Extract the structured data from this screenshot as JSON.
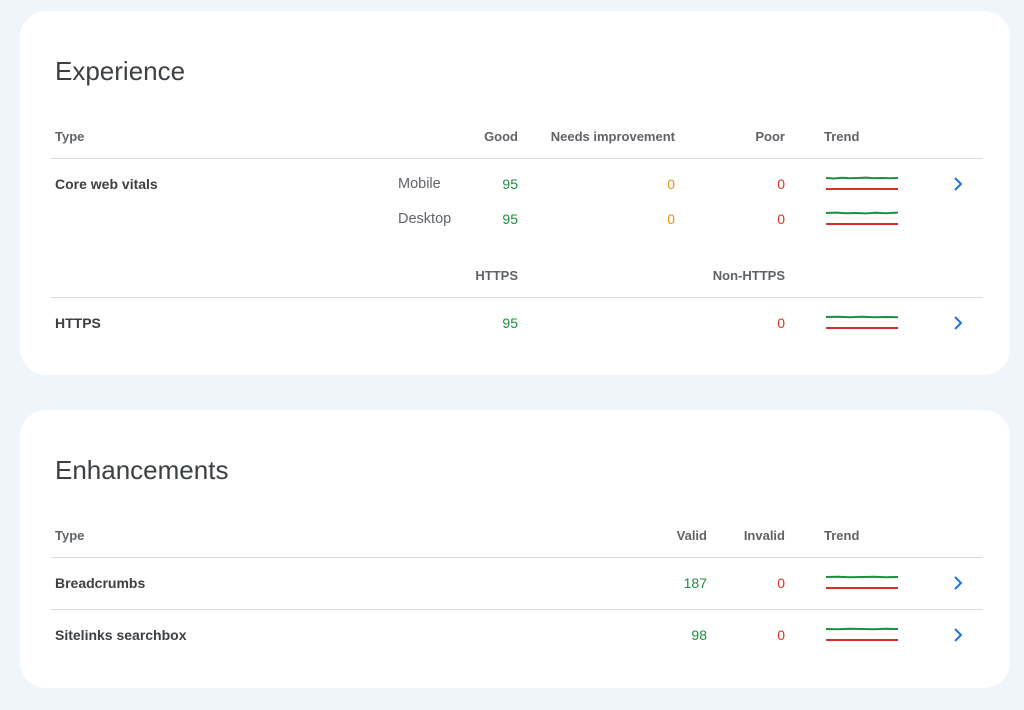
{
  "experience": {
    "title": "Experience",
    "headers": {
      "type": "Type",
      "good": "Good",
      "needs": "Needs improvement",
      "poor": "Poor",
      "trend": "Trend"
    },
    "core_web_vitals": {
      "name": "Core web vitals",
      "mobile": {
        "device": "Mobile",
        "good": "95",
        "needs": "0",
        "poor": "0"
      },
      "desktop": {
        "device": "Desktop",
        "good": "95",
        "needs": "0",
        "poor": "0"
      }
    },
    "https_headers": {
      "https": "HTTPS",
      "non_https": "Non-HTTPS"
    },
    "https_row": {
      "name": "HTTPS",
      "https": "95",
      "non_https": "0"
    }
  },
  "enhancements": {
    "title": "Enhancements",
    "headers": {
      "type": "Type",
      "valid": "Valid",
      "invalid": "Invalid",
      "trend": "Trend"
    },
    "rows": [
      {
        "name": "Breadcrumbs",
        "valid": "187",
        "invalid": "0"
      },
      {
        "name": "Sitelinks searchbox",
        "valid": "98",
        "invalid": "0"
      }
    ]
  },
  "icons": {
    "row_link": "chevron-right-icon"
  },
  "colors": {
    "good": "#1e8e3e",
    "needs": "#e8900c",
    "poor": "#d93025",
    "link": "#1a73e8",
    "background": "#f0f4fb"
  }
}
